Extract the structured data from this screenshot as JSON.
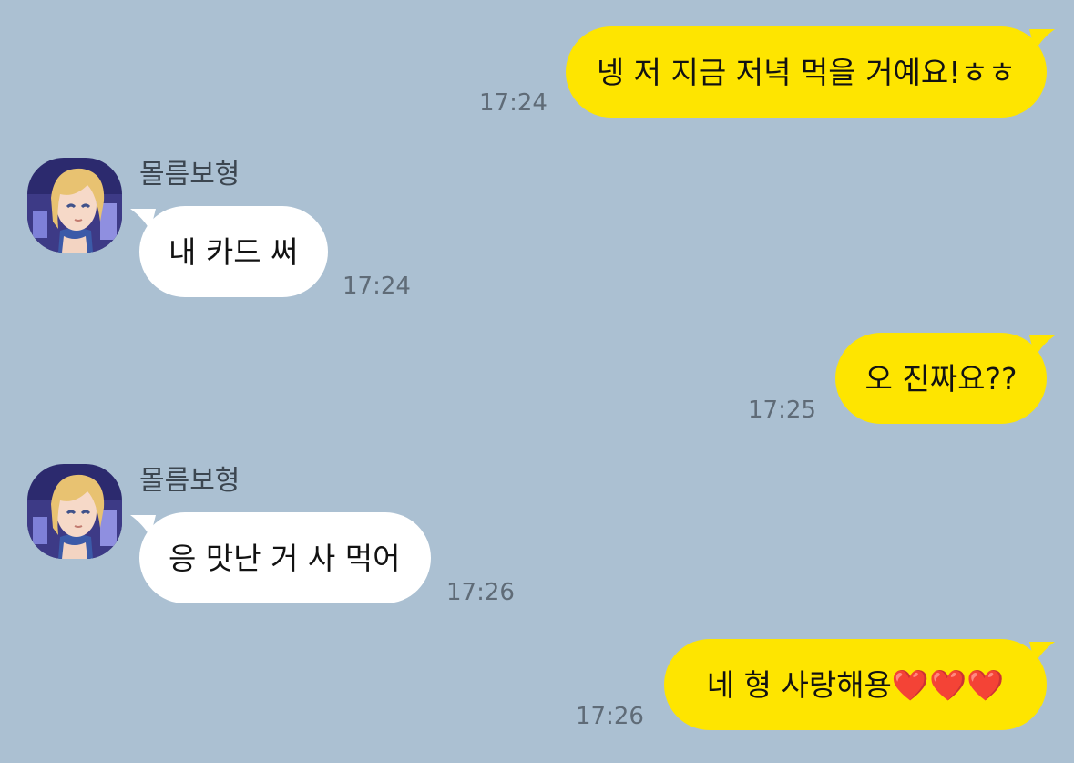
{
  "colors": {
    "background": "#abc0d2",
    "my_bubble": "#fee500",
    "their_bubble": "#ffffff",
    "time_text": "#5f6b77"
  },
  "messages": [
    {
      "from": "me",
      "text": "넹 저 지금 저녁 먹을 거예요!ㅎㅎ",
      "time": "17:24"
    },
    {
      "from": "them",
      "sender": "몰름보형",
      "avatar": "profile-avatar",
      "text": "내 카드 써",
      "time": "17:24"
    },
    {
      "from": "me",
      "text": "오 진짜요??",
      "time": "17:25"
    },
    {
      "from": "them",
      "sender": "몰름보형",
      "avatar": "profile-avatar",
      "text": "응 맛난 거 사 먹어",
      "time": "17:26"
    },
    {
      "from": "me",
      "text": "네 형 사랑해용",
      "emoji": "❤️❤️❤️",
      "time": "17:26"
    }
  ]
}
